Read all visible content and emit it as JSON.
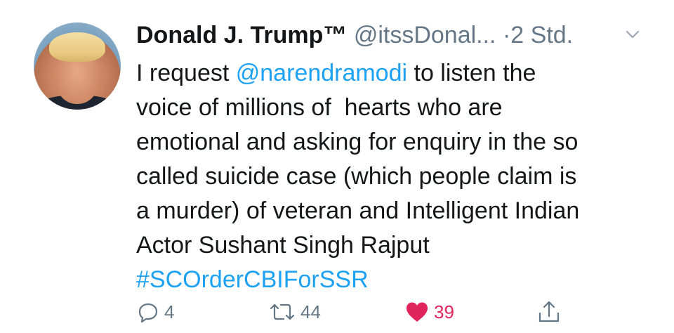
{
  "tweet": {
    "author_name": "Donald J. Trump™",
    "handle": "@itssDonal...",
    "separator": "·",
    "time": "2 Std.",
    "text_lines": [
      {
        "pre": "I request ",
        "mention": "@narendramodi",
        "post": " to listen the"
      },
      "voice of millions of  hearts who are",
      "emotional and asking for enquiry in the so",
      "called suicide case (which people claim is",
      "a murder) of veteran and Intelligent Indian",
      "Actor Sushant Singh Rajput"
    ],
    "hashtag": "#SCOrderCBIForSSR"
  },
  "actions": {
    "reply_count": "4",
    "retweet_count": "44",
    "like_count": "39"
  },
  "colors": {
    "link": "#1da1f2",
    "muted": "#657786",
    "like": "#e0245e",
    "text": "#14171a"
  },
  "icons": [
    "reply-icon",
    "retweet-icon",
    "like-icon",
    "share-icon",
    "chevron-down-icon"
  ]
}
